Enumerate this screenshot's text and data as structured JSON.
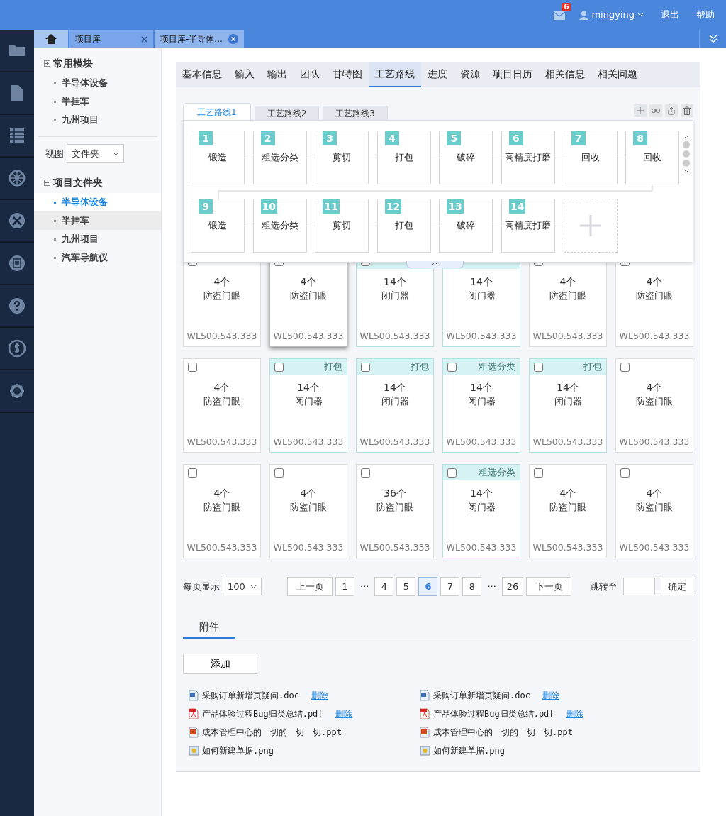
{
  "topbar": {
    "mail_count": "6",
    "user": "mingying",
    "links": [
      "退出",
      "帮助"
    ]
  },
  "page_tabs": [
    {
      "kind": "home",
      "selected": false
    },
    {
      "kind": "tab",
      "label": "项目库",
      "selected": false
    },
    {
      "kind": "tab",
      "label": "项目库-半导体...",
      "selected": true
    }
  ],
  "rail": [
    {
      "kind": "folder"
    },
    {
      "kind": "file"
    },
    {
      "kind": "table"
    },
    {
      "kind": "wheel"
    },
    {
      "kind": "tools"
    },
    {
      "kind": "list"
    },
    {
      "kind": "help"
    },
    {
      "kind": "money"
    },
    {
      "kind": "settings"
    }
  ],
  "sidebar": {
    "groups": [
      {
        "title": "常用模块",
        "expanded": false,
        "items": [
          {
            "label": "半导体设备",
            "selected": false,
            "hovered": false
          },
          {
            "label": "半挂车",
            "selected": false,
            "hovered": false
          },
          {
            "label": "九州项目",
            "selected": false,
            "hovered": false
          }
        ]
      }
    ],
    "view_label": "视图",
    "view_value": "文件夹",
    "folders": {
      "title": "项目文件夹",
      "expanded": true,
      "items": [
        {
          "label": "半导体设备",
          "selected": true,
          "hovered": false
        },
        {
          "label": "半挂车",
          "selected": false,
          "hovered": true
        },
        {
          "label": "九州项目",
          "selected": false,
          "hovered": false
        },
        {
          "label": "汽车导航仪",
          "selected": false,
          "hovered": false
        }
      ]
    }
  },
  "nav": [
    {
      "label": "基本信息",
      "selected": false
    },
    {
      "label": "输入",
      "selected": false
    },
    {
      "label": "输出",
      "selected": false
    },
    {
      "label": "团队",
      "selected": false
    },
    {
      "label": "甘特图",
      "selected": false
    },
    {
      "label": "工艺路线",
      "selected": true
    },
    {
      "label": "进度",
      "selected": false
    },
    {
      "label": "资源",
      "selected": false
    },
    {
      "label": "项目日历",
      "selected": false
    },
    {
      "label": "相关信息",
      "selected": false
    },
    {
      "label": "相关问题",
      "selected": false
    }
  ],
  "route": {
    "tabs": [
      {
        "label": "工艺路线1",
        "selected": true
      },
      {
        "label": "工艺路线2",
        "selected": false
      },
      {
        "label": "工艺路线3",
        "selected": false
      }
    ],
    "tools": [
      {
        "kind": "add"
      },
      {
        "kind": "link"
      },
      {
        "kind": "export"
      },
      {
        "kind": "delete"
      }
    ],
    "rows": [
      [
        {
          "num": "1",
          "label": "锻造"
        },
        {
          "num": "2",
          "label": "粗选分类"
        },
        {
          "num": "3",
          "label": "剪切"
        },
        {
          "num": "4",
          "label": "打包"
        },
        {
          "num": "5",
          "label": "破碎"
        },
        {
          "num": "6",
          "label": "高精度打磨"
        },
        {
          "num": "7",
          "label": "回收"
        },
        {
          "num": "8",
          "label": "回收"
        }
      ],
      [
        {
          "num": "9",
          "label": "锻造"
        },
        {
          "num": "10",
          "label": "粗选分类"
        },
        {
          "num": "11",
          "label": "剪切"
        },
        {
          "num": "12",
          "label": "打包"
        },
        {
          "num": "13",
          "label": "破碎"
        },
        {
          "num": "14",
          "label": "高精度打磨"
        }
      ]
    ]
  },
  "cards": [
    {
      "count": "4个",
      "name": "防盗门眼",
      "code": "WL500.543.333",
      "highlighted": false,
      "raised": false,
      "checked": false
    },
    {
      "count": "4个",
      "name": "防盗门眼",
      "code": "WL500.543.333",
      "highlighted": false,
      "raised": true,
      "checked": false
    },
    {
      "count": "14个",
      "name": "闭门器",
      "code": "WL500.543.333",
      "highlighted": true,
      "raised": false,
      "checked": false
    },
    {
      "count": "14个",
      "name": "闭门器",
      "code": "WL500.543.333",
      "highlighted": true,
      "raised": false
    },
    {
      "count": "4个",
      "name": "防盗门眼",
      "code": "WL500.543.333",
      "highlighted": false,
      "raised": false,
      "checked": false
    },
    {
      "count": "4个",
      "name": "防盗门眼",
      "code": "WL500.543.333",
      "highlighted": false,
      "raised": false,
      "checked": false
    },
    {
      "count": "4个",
      "name": "防盗门眼",
      "code": "WL500.543.333",
      "highlighted": false,
      "raised": false,
      "checked": false
    },
    {
      "tag": "打包",
      "count": "14个",
      "name": "闭门器",
      "code": "WL500.543.333",
      "highlighted": true,
      "raised": false,
      "checked": false
    },
    {
      "tag": "打包",
      "count": "14个",
      "name": "闭门器",
      "code": "WL500.543.333",
      "highlighted": true,
      "raised": false,
      "checked": false
    },
    {
      "tag": "粗选分类",
      "count": "14个",
      "name": "闭门器",
      "code": "WL500.543.333",
      "highlighted": true,
      "raised": false,
      "checked": false
    },
    {
      "tag": "打包",
      "count": "14个",
      "name": "闭门器",
      "code": "WL500.543.333",
      "highlighted": true,
      "raised": false,
      "checked": false
    },
    {
      "count": "4个",
      "name": "防盗门眼",
      "code": "WL500.543.333",
      "highlighted": false,
      "raised": false,
      "checked": false
    },
    {
      "count": "4个",
      "name": "防盗门眼",
      "code": "WL500.543.333",
      "highlighted": false,
      "raised": false,
      "checked": false
    },
    {
      "count": "4个",
      "name": "防盗门眼",
      "code": "WL500.543.333",
      "highlighted": false,
      "raised": false,
      "checked": false
    },
    {
      "count": "36个",
      "name": "防盗门眼",
      "code": "WL500.543.333",
      "highlighted": false,
      "raised": false,
      "checked": false
    },
    {
      "tag": "粗选分类",
      "count": "14个",
      "name": "闭门器",
      "code": "WL500.543.333",
      "highlighted": true,
      "raised": false,
      "checked": false
    },
    {
      "count": "4个",
      "name": "防盗门眼",
      "code": "WL500.543.333",
      "highlighted": false,
      "raised": false,
      "checked": false
    },
    {
      "count": "4个",
      "name": "防盗门眼",
      "code": "WL500.543.333",
      "highlighted": false,
      "raised": false,
      "checked": false
    }
  ],
  "pagination": {
    "per_page_label": "每页显示",
    "per_page": "100",
    "prev": "上一页",
    "next": "下一页",
    "pages": [
      {
        "kind": "page",
        "label": "1",
        "selected": false
      },
      {
        "kind": "gap",
        "label": "···"
      },
      {
        "kind": "page",
        "label": "4",
        "selected": false
      },
      {
        "kind": "page",
        "label": "5",
        "selected": false
      },
      {
        "kind": "page",
        "label": "6",
        "selected": true
      },
      {
        "kind": "page",
        "label": "7",
        "selected": false
      },
      {
        "kind": "page",
        "label": "8",
        "selected": false
      },
      {
        "kind": "gap",
        "label": "···"
      },
      {
        "kind": "page",
        "label": "26",
        "selected": false
      }
    ],
    "jump_label": "跳转至",
    "confirm": "确定"
  },
  "attachments": {
    "tab": "附件",
    "add": "添加",
    "columns": [
      [
        {
          "kind": "doc",
          "name": "采购订单新增页疑问.doc",
          "delete": "删除"
        },
        {
          "kind": "pdf",
          "name": "产品体验过程Bug归类总结.pdf",
          "delete": "删除"
        },
        {
          "kind": "ppt",
          "name": "成本管理中心的一切的一切一切.ppt"
        },
        {
          "kind": "png",
          "name": "如何新建单据.png"
        }
      ],
      [
        {
          "kind": "doc",
          "name": "采购订单新增页疑问.doc",
          "delete": "删除"
        },
        {
          "kind": "pdf",
          "name": "产品体验过程Bug归类总结.pdf",
          "delete": "删除"
        },
        {
          "kind": "ppt",
          "name": "成本管理中心的一切的一切一切.ppt"
        },
        {
          "kind": "png",
          "name": "如何新建单据.png"
        }
      ]
    ]
  }
}
